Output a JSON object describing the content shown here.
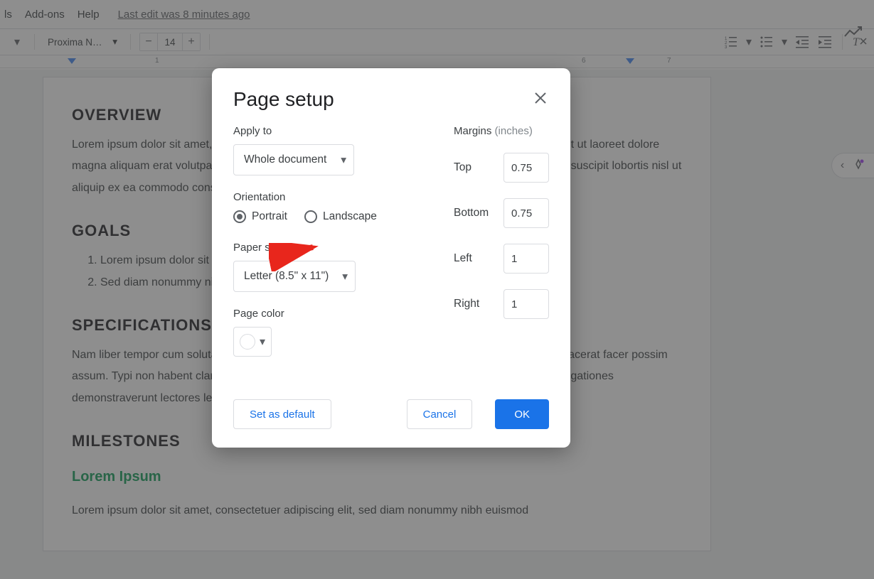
{
  "menu": {
    "tools_fragment": "ls",
    "addons": "Add-ons",
    "help": "Help",
    "edit_info": "Last edit was 8 minutes ago"
  },
  "toolbar": {
    "font_name": "Proxima N…",
    "font_size": "14"
  },
  "ruler": {
    "marks": [
      "1",
      "6",
      "7"
    ]
  },
  "document": {
    "h_overview": "OVERVIEW",
    "p_overview": "Lorem ipsum dolor sit amet, consectetuer adipiscing elit, sed diam nonummy nibh euismod tincidunt ut laoreet dolore magna aliquam erat volutpat. Ut wisi enim ad minim veniam, quis nostrud exerci tation ullamcorper suscipit lobortis nisl ut aliquip ex ea commodo consequat.",
    "h_goals": "GOALS",
    "goal1": "Lorem ipsum dolor sit amet, consectetuer adipiscing elit.",
    "goal2": "Sed diam nonummy nibh euismod tincidunt ut laoreet dolore magna aliquam erat volutpat.",
    "h_specs": "SPECIFICATIONS",
    "p_specs": "Nam liber tempor cum soluta nobis eleifend option congue nihil imperdiet doming id quod mazim placerat facer possim assum. Typi non habent claritatem insitam; est usus legentis in iis qui facit eorum claritatem. Investigationes demonstraverunt lectores legere me lius quod ii legunt saepius.",
    "h_milestones": "MILESTONES",
    "green_heading": "Lorem Ipsum",
    "p_last": "Lorem ipsum dolor sit amet, consectetuer adipiscing elit, sed diam nonummy nibh euismod"
  },
  "dialog": {
    "title": "Page setup",
    "apply_to_label": "Apply to",
    "apply_to_value": "Whole document",
    "orientation_label": "Orientation",
    "portrait": "Portrait",
    "landscape": "Landscape",
    "paper_size_label": "Paper size",
    "paper_size_value": "Letter (8.5\" x 11\")",
    "page_color_label": "Page color",
    "margins_label": "Margins",
    "margins_unit": "(inches)",
    "margin_top_label": "Top",
    "margin_top_value": "0.75",
    "margin_bottom_label": "Bottom",
    "margin_bottom_value": "0.75",
    "margin_left_label": "Left",
    "margin_left_value": "1",
    "margin_right_label": "Right",
    "margin_right_value": "1",
    "set_default": "Set as default",
    "cancel": "Cancel",
    "ok": "OK"
  }
}
